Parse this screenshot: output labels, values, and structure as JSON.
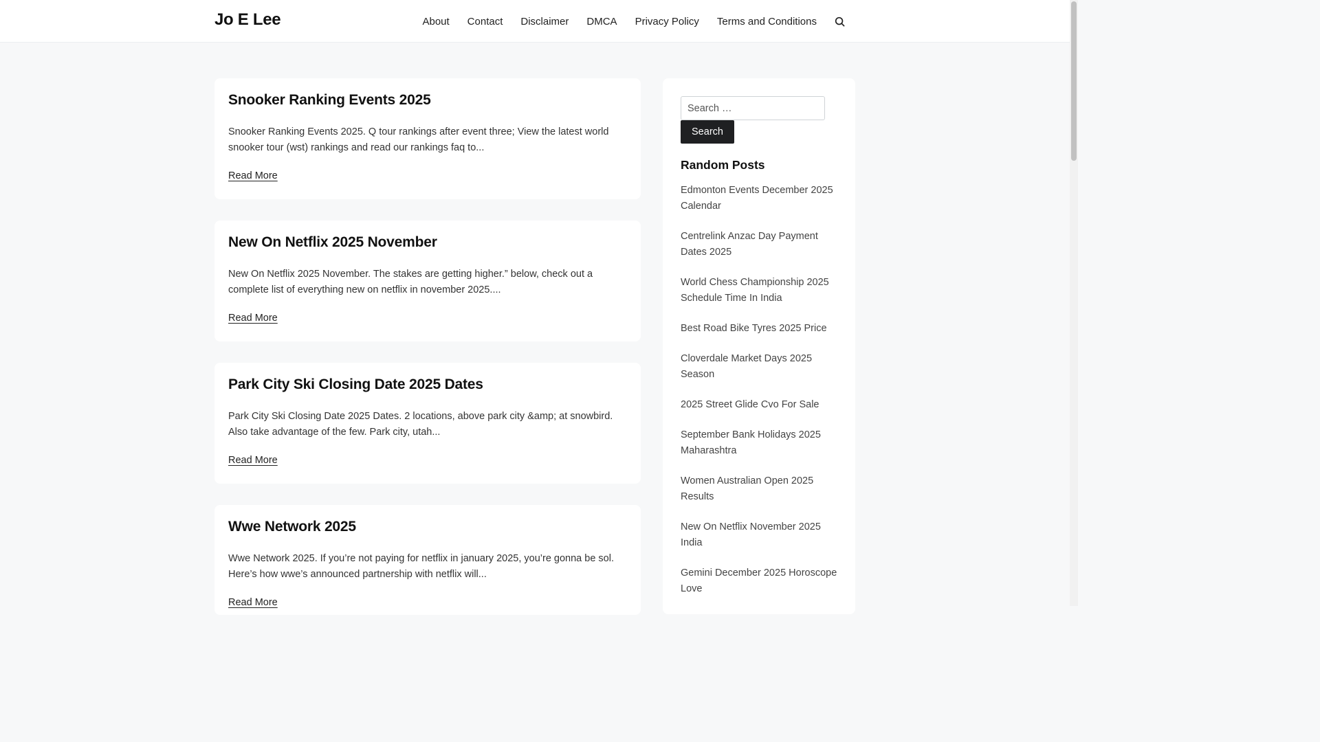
{
  "site": {
    "title": "Jo E Lee"
  },
  "nav": {
    "items": [
      {
        "label": "About"
      },
      {
        "label": "Contact"
      },
      {
        "label": "Disclaimer"
      },
      {
        "label": "DMCA"
      },
      {
        "label": "Privacy Policy"
      },
      {
        "label": "Terms and Conditions"
      }
    ],
    "search_icon": "search-icon"
  },
  "posts": [
    {
      "title": "Snooker Ranking Events 2025",
      "excerpt": "Snooker Ranking Events 2025. Q tour rankings after event three; View the latest world snooker tour (wst) rankings and read our rankings faq to...",
      "read_more": "Read More"
    },
    {
      "title": "New On Netflix 2025 November",
      "excerpt": "New On Netflix 2025 November. The stakes are getting higher.” below, check out a complete list of everything new on netflix in november 2025....",
      "read_more": "Read More"
    },
    {
      "title": "Park City Ski Closing Date 2025 Dates",
      "excerpt": "Park City Ski Closing Date 2025 Dates. 2 locations, above park city &amp; at snowbird. Also take advantage of the few. Park city, utah...",
      "read_more": "Read More"
    },
    {
      "title": "Wwe Network 2025",
      "excerpt": "Wwe Network 2025. If you’re not paying for netflix in january 2025, you’re gonna be sol. Here’s how wwe’s announced partnership with netflix will...",
      "read_more": "Read More"
    }
  ],
  "sidebar": {
    "search": {
      "placeholder": "Search …",
      "button_label": "Search"
    },
    "random_posts": {
      "title": "Random Posts",
      "items": [
        "Edmonton Events December 2025 Calendar",
        "Centrelink Anzac Day Payment Dates 2025",
        "World Chess Championship 2025 Schedule Time In India",
        "Best Road Bike Tyres 2025 Price",
        "Cloverdale Market Days 2025 Season",
        "2025 Street Glide Cvo For Sale",
        "September Bank Holidays 2025 Maharashtra",
        "Women Australian Open 2025 Results",
        "New On Netflix November 2025 India",
        "Gemini December 2025 Horoscope Love"
      ]
    }
  }
}
